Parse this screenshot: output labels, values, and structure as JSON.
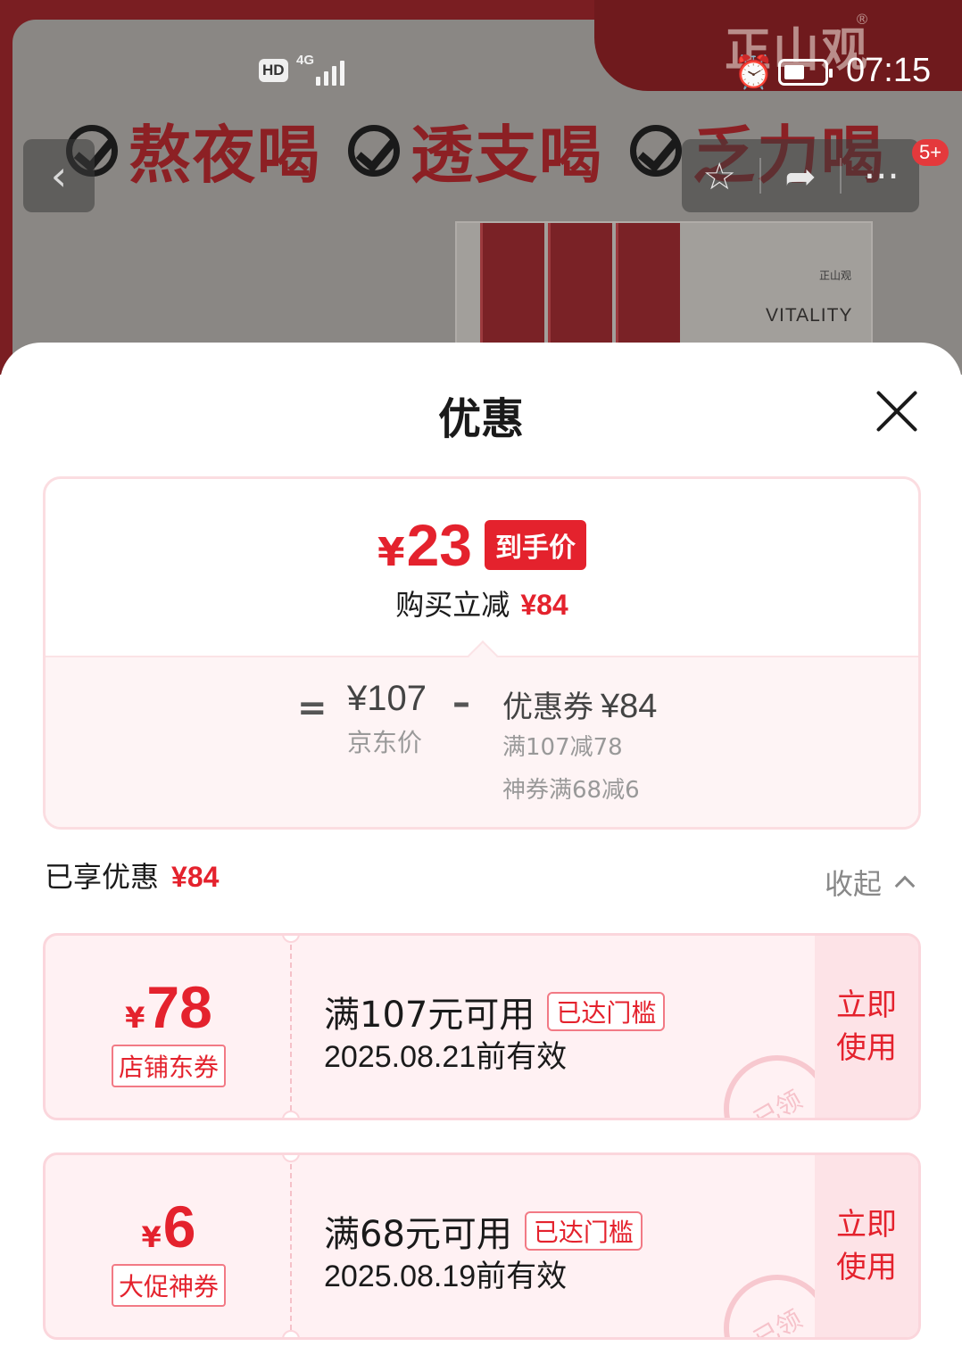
{
  "background": {
    "brand_logo": "正山观",
    "slogans": [
      "熬夜喝",
      "透支喝",
      "乏力喝"
    ],
    "product_text": "VITALITY",
    "box_logo": "正山观",
    "cart_badge": "5+"
  },
  "status_bar": {
    "hd": "HD",
    "network": "4G",
    "time": "07:15"
  },
  "sheet": {
    "title": "优惠",
    "price": {
      "currency": "¥",
      "final_price": "23",
      "final_tag": "到手价",
      "reduce_label": "购买立减",
      "reduce_amount": "¥84",
      "eq": "=",
      "jd_price": "¥107",
      "jd_label": "京东价",
      "minus": "–",
      "coupon_label": "优惠券",
      "coupon_total": "¥84",
      "coupon_detail_1": "满107减78",
      "coupon_detail_2": "神券满68减6"
    },
    "enjoyed": {
      "label": "已享优惠",
      "amount": "¥84",
      "collapse": "收起"
    },
    "coupons": [
      {
        "currency": "¥",
        "amount": "78",
        "type": "店铺东券",
        "condition": "满107元可用",
        "status_tag": "已达门槛",
        "validity": "2025.08.21前有效",
        "stamp": "已领",
        "action": "立即使用"
      },
      {
        "currency": "¥",
        "amount": "6",
        "type": "大促神券",
        "condition": "满68元可用",
        "status_tag": "已达门槛",
        "validity": "2025.08.19前有效",
        "stamp": "已领",
        "action": "立即使用"
      }
    ]
  },
  "colors": {
    "accent": "#e4222d",
    "coupon_bg": "#fff1f3",
    "coupon_border": "#fbd6dc"
  }
}
